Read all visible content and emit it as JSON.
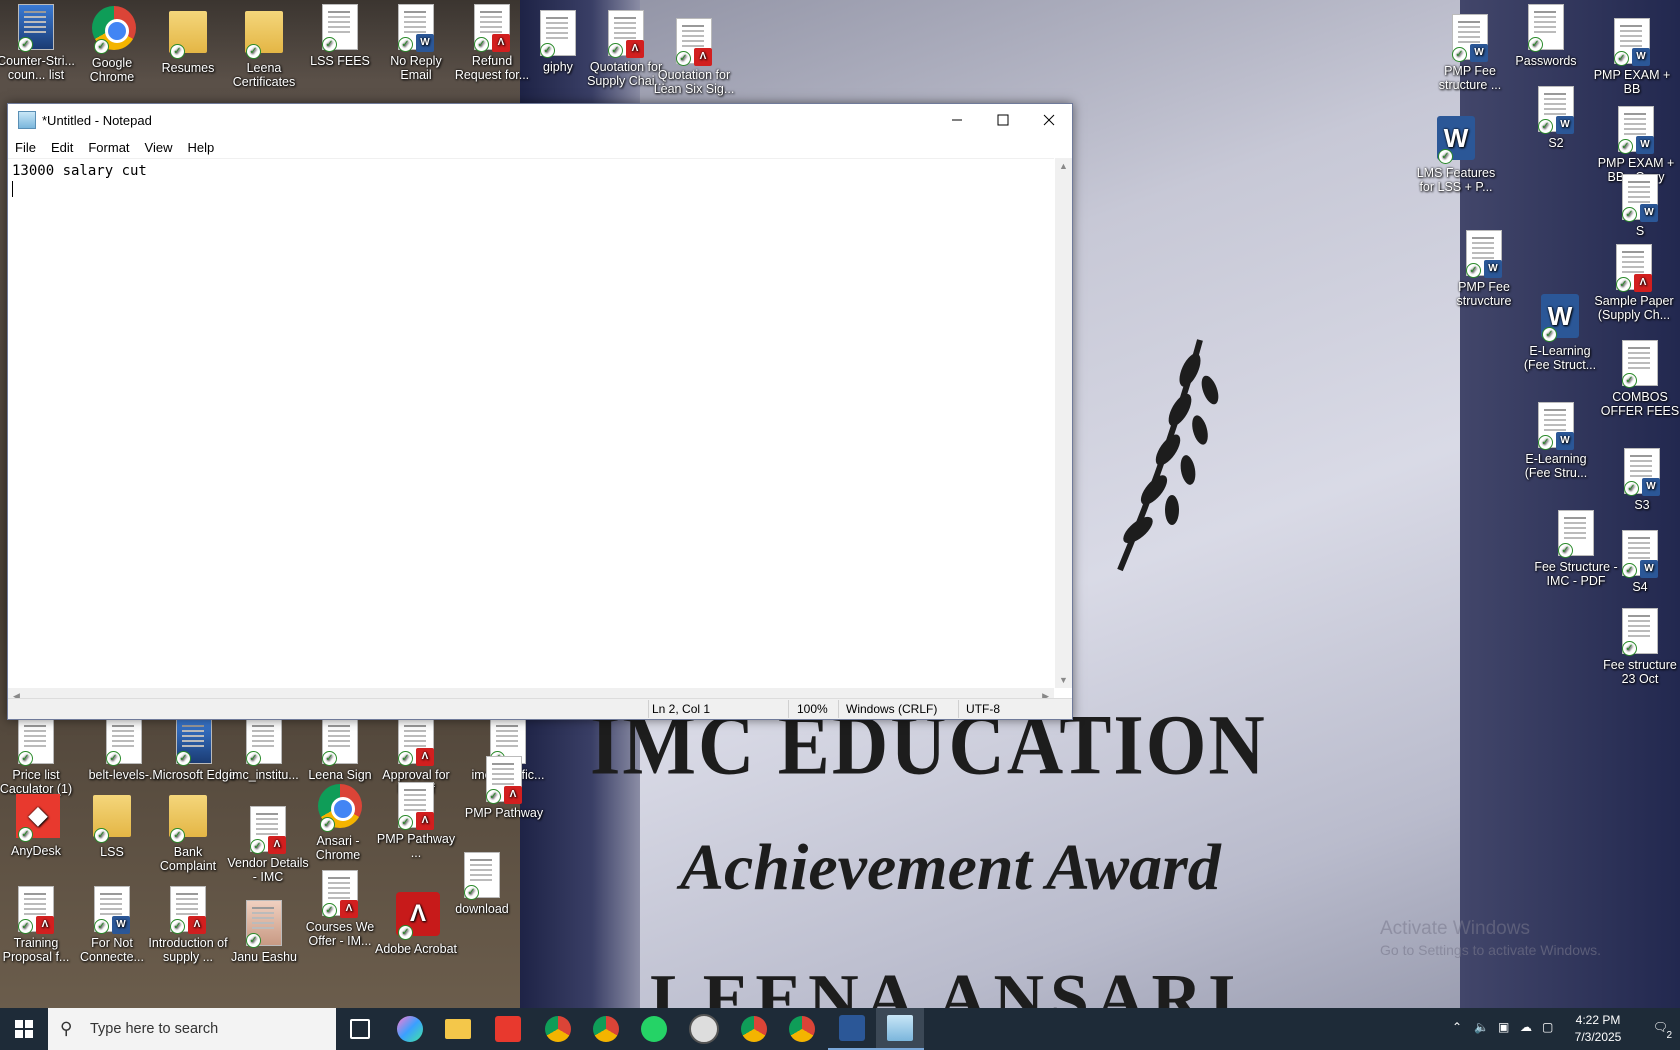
{
  "desktop": {
    "plaque": {
      "title": "IMC EDUCATION",
      "subtitle": "Achievement Award",
      "name": "LEENA ANSARI"
    },
    "watermark": {
      "line1": "Activate Windows",
      "line2": "Go to Settings to activate Windows."
    },
    "icons_top": [
      {
        "label": "Counter-Stri... coun... list",
        "kind": "app"
      },
      {
        "label": "Google Chrome",
        "kind": "chrome"
      },
      {
        "label": "Resumes",
        "kind": "folder"
      },
      {
        "label": "Leena Certificates",
        "kind": "folder"
      },
      {
        "label": "LSS FEES",
        "kind": "doc"
      },
      {
        "label": "No Reply Email",
        "kind": "word"
      },
      {
        "label": "Refund Request for...",
        "kind": "pdf"
      },
      {
        "label": "giphy",
        "kind": "doc"
      },
      {
        "label": "Quotation for Supply Chai...",
        "kind": "pdf"
      },
      {
        "label": "Quotation for Lean Six Sig...",
        "kind": "pdf"
      }
    ],
    "icons_right": [
      {
        "label": "PMP Fee structure ...",
        "kind": "word"
      },
      {
        "label": "Passwords",
        "kind": "doc"
      },
      {
        "label": "PMP EXAM + BB",
        "kind": "word"
      },
      {
        "label": "S2",
        "kind": "word"
      },
      {
        "label": "LMS Features for LSS + P...",
        "kind": "wordbig"
      },
      {
        "label": "PMP EXAM + BB - Copy",
        "kind": "word"
      },
      {
        "label": "S",
        "kind": "word"
      },
      {
        "label": "PMP Fee struvcture",
        "kind": "word"
      },
      {
        "label": "Sample Paper (Supply Ch...",
        "kind": "pdf"
      },
      {
        "label": "E-Learning (Fee Struct...",
        "kind": "wordbig"
      },
      {
        "label": "COMBOS OFFER FEES",
        "kind": "doc"
      },
      {
        "label": "E-Learning (Fee Stru...",
        "kind": "word"
      },
      {
        "label": "S3",
        "kind": "word"
      },
      {
        "label": "Fee Structure - IMC - PDF",
        "kind": "doc"
      },
      {
        "label": "S4",
        "kind": "word"
      },
      {
        "label": "Fee structure 23 Oct",
        "kind": "doc"
      }
    ],
    "icons_bottom": [
      {
        "label": "Price list Caculator (1)",
        "kind": "doc"
      },
      {
        "label": "belt-levels-...",
        "kind": "doc"
      },
      {
        "label": "Microsoft Edge",
        "kind": "app"
      },
      {
        "label": "imc_institu...",
        "kind": "doc"
      },
      {
        "label": "Leena Sign",
        "kind": "doc"
      },
      {
        "label": "Approval for M. Asif",
        "kind": "pdf"
      },
      {
        "label": "imc_certific...",
        "kind": "doc"
      },
      {
        "label": "PMP Pathway",
        "kind": "pdf"
      },
      {
        "label": "AnyDesk",
        "kind": "anydesk"
      },
      {
        "label": "LSS",
        "kind": "folder"
      },
      {
        "label": "Bank Complaint",
        "kind": "folder"
      },
      {
        "label": "Vendor Details - IMC",
        "kind": "pdf"
      },
      {
        "label": "Ansari - Chrome",
        "kind": "chrome"
      },
      {
        "label": "PMP Pathway ...",
        "kind": "pdf"
      },
      {
        "label": "download",
        "kind": "doc"
      },
      {
        "label": "Training Proposal f...",
        "kind": "pdf"
      },
      {
        "label": "For Not Connecte...",
        "kind": "word"
      },
      {
        "label": "Introduction of supply ...",
        "kind": "pdf"
      },
      {
        "label": "Janu Eashu",
        "kind": "photo"
      },
      {
        "label": "Courses We Offer - IM...",
        "kind": "pdf"
      },
      {
        "label": "Adobe Acrobat",
        "kind": "acrobat"
      }
    ]
  },
  "notepad": {
    "title": "*Untitled - Notepad",
    "menu": [
      "File",
      "Edit",
      "Format",
      "View",
      "Help"
    ],
    "text": "13000 salary cut",
    "status": {
      "position": "Ln 2, Col 1",
      "zoom": "100%",
      "line_ending": "Windows (CRLF)",
      "encoding": "UTF-8"
    }
  },
  "taskbar": {
    "search_placeholder": "Type here to search",
    "time": "4:22 PM",
    "date": "7/3/2025",
    "notification_count": "2"
  }
}
